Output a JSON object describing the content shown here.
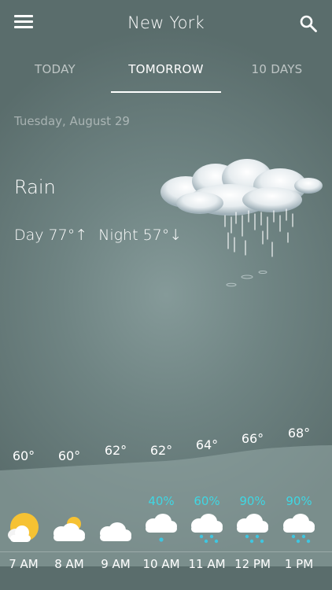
{
  "header": {
    "title": "New York"
  },
  "tabs": [
    {
      "label": "TODAY",
      "active": false
    },
    {
      "label": "TOMORROW",
      "active": true
    },
    {
      "label": "10 DAYS",
      "active": false
    }
  ],
  "forecast": {
    "date": "Tuesday, August 29",
    "condition": "Rain",
    "day_label": "Day 77°↑",
    "night_label": "Night 57°↓"
  },
  "hourly": [
    {
      "time": "7 AM",
      "temp": "60°",
      "precip": "",
      "icon": "sunny-cloud-icon"
    },
    {
      "time": "8 AM",
      "temp": "60°",
      "precip": "",
      "icon": "partly-cloudy-icon"
    },
    {
      "time": "9 AM",
      "temp": "62°",
      "precip": "",
      "icon": "cloudy-icon"
    },
    {
      "time": "10 AM",
      "temp": "62°",
      "precip": "40%",
      "icon": "light-rain-icon"
    },
    {
      "time": "11 AM",
      "temp": "64°",
      "precip": "60%",
      "icon": "rain-icon"
    },
    {
      "time": "12 PM",
      "temp": "66°",
      "precip": "90%",
      "icon": "rain-icon"
    },
    {
      "time": "1 PM",
      "temp": "68°",
      "precip": "90%",
      "icon": "rain-icon"
    }
  ],
  "colors": {
    "precip": "#3fd7e3",
    "rain_drop": "#3fc6e0",
    "sun": "#f6c233"
  }
}
